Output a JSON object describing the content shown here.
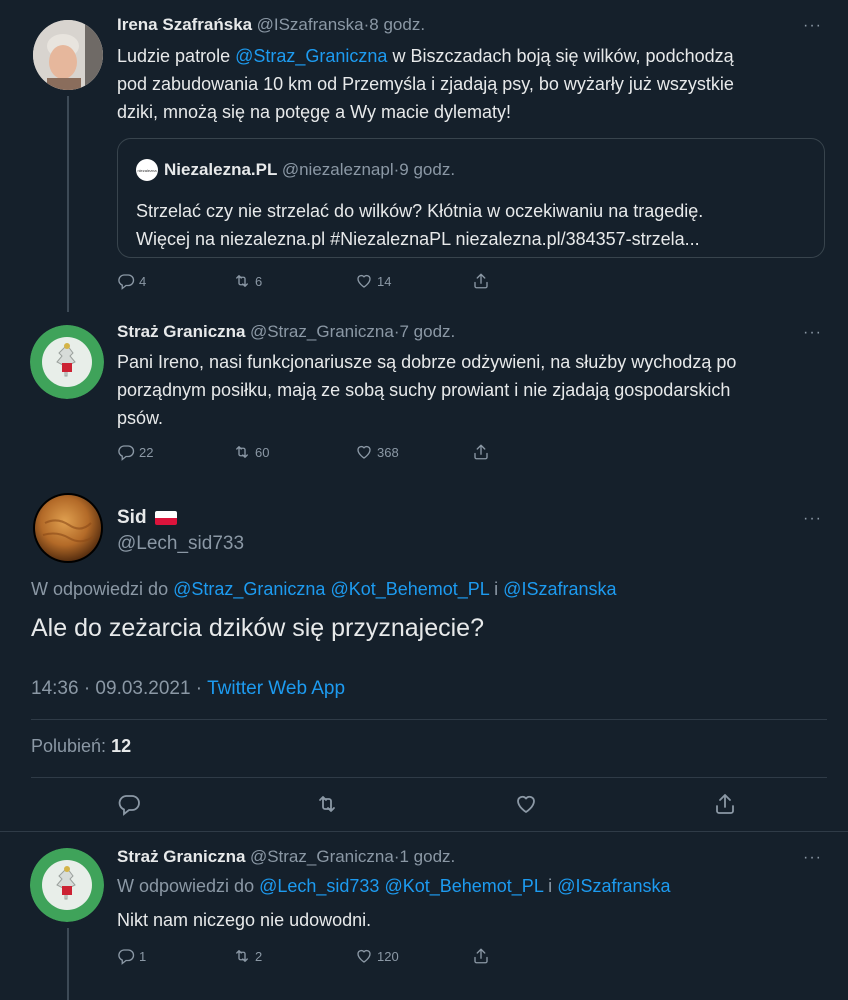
{
  "tweet1": {
    "author": "Irena Szafrańska",
    "handle": "@ISzafranska",
    "dot": "·",
    "time": "8 godz.",
    "text_pre": "Ludzie patrole ",
    "mention": "@Straz_Graniczna",
    "text_post_line1": " w Biszczadach boją się wilków, podchodzą",
    "line2": "pod zabudowania 10 km od Przemyśla i zjadają psy, bo wyżarły już wszystkie",
    "line3": "dziki, mnożą się na potęgę a Wy macie dylematy!",
    "quote": {
      "logo_text": "niezalezna",
      "author": "Niezalezna.PL",
      "handle": "@niezaleznapl",
      "dot": "·",
      "time": "9 godz.",
      "line1": "Strzelać czy nie strzelać do wilków? Kłótnia w oczekiwaniu na tragedię.",
      "line2": "Więcej na niezalezna.pl #NiezaleznaPL niezalezna.pl/384357-strzela..."
    },
    "replies": "4",
    "retweets": "6",
    "likes": "14"
  },
  "tweet2": {
    "author": "Straż Graniczna",
    "handle": "@Straz_Graniczna",
    "dot": "·",
    "time": "7 godz.",
    "line1": "Pani Ireno, nasi funkcjonariusze są dobrze odżywieni, na służby wychodzą po",
    "line2": "porządnym posiłku, mają ze sobą suchy prowiant i nie zjadają gospodarskich",
    "line3": "psów.",
    "replies": "22",
    "retweets": "60",
    "likes": "368"
  },
  "main": {
    "author": "Sid",
    "handle": "@Lech_sid733",
    "reply_prefix": "W odpowiedzi do ",
    "reply_to_1": "@Straz_Graniczna",
    "reply_to_2": "@Kot_Behemot_PL",
    "reply_and": " i ",
    "reply_to_3": "@ISzafranska",
    "text": "Ale do zeżarcia dzików się przyznajecie?",
    "time": "14:36 · 09.03.2021 · ",
    "source": "Twitter Web App",
    "likes_label": "Polubień: ",
    "likes_count": "12"
  },
  "tweet3": {
    "author": "Straż Graniczna",
    "handle": "@Straz_Graniczna",
    "dot": "·",
    "time": "1 godz.",
    "reply_prefix": "W odpowiedzi do ",
    "reply_to_1": "@Lech_sid733",
    "reply_to_2": "@Kot_Behemot_PL",
    "reply_and": " i ",
    "reply_to_3": "@ISzafranska",
    "text": "Nikt nam niczego nie udowodni.",
    "replies": "1",
    "retweets": "2",
    "likes": "120"
  },
  "more_glyph": "···",
  "colors": {
    "background": "#15202b",
    "accent": "#1d9bf0",
    "muted": "#8b98a5"
  }
}
